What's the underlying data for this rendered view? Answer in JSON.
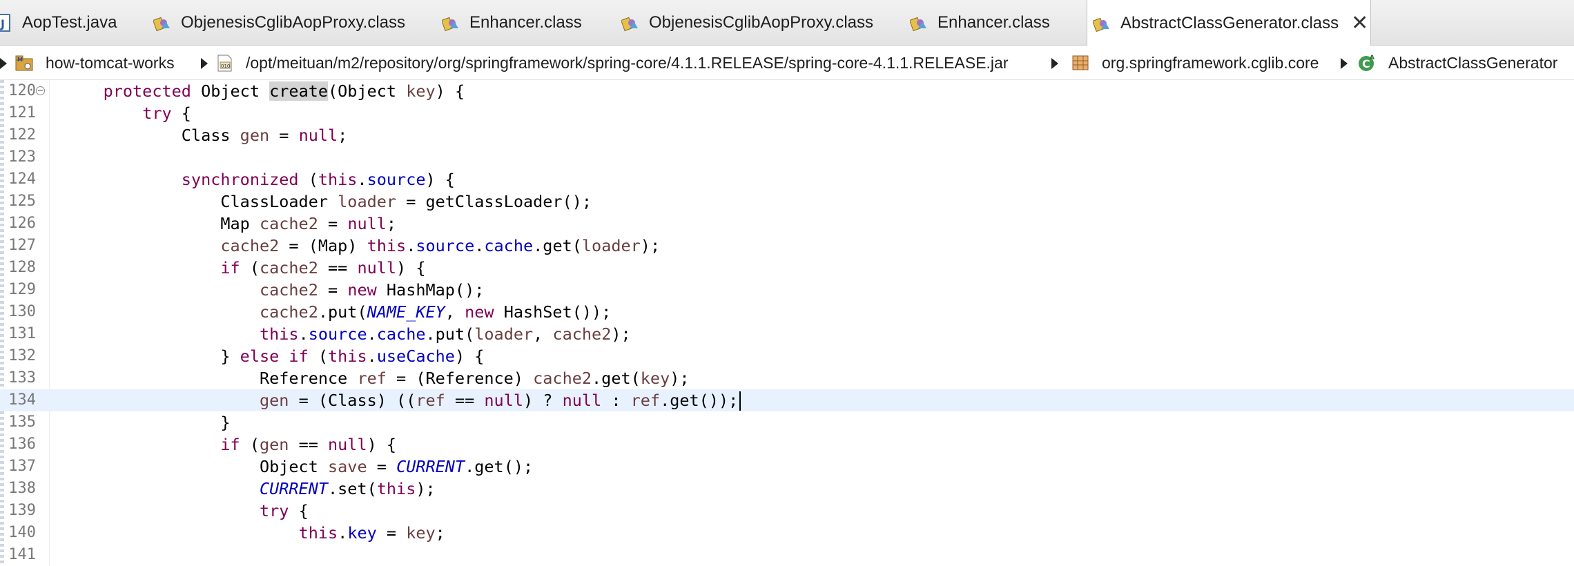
{
  "tabs": [
    {
      "label": "AopTest.java",
      "icon": "java-file-icon"
    },
    {
      "label": "ObjenesisCglibAopProxy.class",
      "icon": "class-file-icon"
    },
    {
      "label": "Enhancer.class",
      "icon": "class-file-icon"
    },
    {
      "label": "ObjenesisCglibAopProxy.class",
      "icon": "class-file-icon"
    },
    {
      "label": "Enhancer.class",
      "icon": "class-file-icon"
    },
    {
      "label": "AbstractClassGenerator.class",
      "icon": "class-file-icon",
      "active": true,
      "close": "✕"
    }
  ],
  "breadcrumb": {
    "project": "how-tomcat-works",
    "jar": "/opt/meituan/m2/repository/org/springframework/spring-core/4.1.1.RELEASE/spring-core-4.1.1.RELEASE.jar",
    "package": "org.springframework.cglib.core",
    "class": "AbstractClassGenerator"
  },
  "editor": {
    "current_line": "134",
    "lines": [
      {
        "n": "120",
        "fold": "−",
        "code": "    protected Object create(Object key) {"
      },
      {
        "n": "121",
        "code": "        try {"
      },
      {
        "n": "122",
        "code": "            Class gen = null;"
      },
      {
        "n": "123",
        "code": ""
      },
      {
        "n": "124",
        "code": "            synchronized (this.source) {"
      },
      {
        "n": "125",
        "code": "                ClassLoader loader = getClassLoader();"
      },
      {
        "n": "126",
        "code": "                Map cache2 = null;"
      },
      {
        "n": "127",
        "code": "                cache2 = (Map) this.source.cache.get(loader);"
      },
      {
        "n": "128",
        "code": "                if (cache2 == null) {"
      },
      {
        "n": "129",
        "code": "                    cache2 = new HashMap();"
      },
      {
        "n": "130",
        "code": "                    cache2.put(NAME_KEY, new HashSet());"
      },
      {
        "n": "131",
        "code": "                    this.source.cache.put(loader, cache2);"
      },
      {
        "n": "132",
        "code": "                } else if (this.useCache) {"
      },
      {
        "n": "133",
        "code": "                    Reference ref = (Reference) cache2.get(key);"
      },
      {
        "n": "134",
        "code": "                    gen = (Class) ((ref == null) ? null : ref.get());"
      },
      {
        "n": "135",
        "code": "                }"
      },
      {
        "n": "136",
        "code": "                if (gen == null) {"
      },
      {
        "n": "137",
        "code": "                    Object save = CURRENT.get();"
      },
      {
        "n": "138",
        "code": "                    CURRENT.set(this);"
      },
      {
        "n": "139",
        "code": "                    try {"
      },
      {
        "n": "140",
        "code": "                        this.key = key;"
      },
      {
        "n": "141",
        "code": ""
      }
    ]
  },
  "colors": {
    "keyword": "#7f0055",
    "local_variable": "#6a3e3e",
    "field": "#0000c0",
    "current_line_bg": "#e8f2fe",
    "tab_bar_bg": "#e8e8e8"
  }
}
